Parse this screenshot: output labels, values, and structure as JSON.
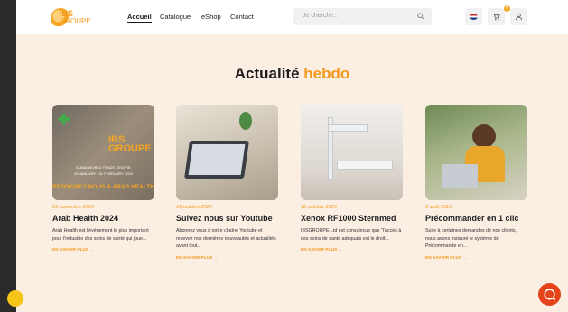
{
  "header": {
    "logo_text": "IBS",
    "logo_sub": "GROUPE",
    "nav": [
      "Accueil",
      "Catalogue",
      "eShop",
      "Contact"
    ],
    "search_placeholder": "Je cherche..",
    "cart_count": "0"
  },
  "section": {
    "title_part1": "Actualité",
    "title_part2": "hebdo"
  },
  "cards": [
    {
      "date": "29 novembre 2023",
      "title": "Arab Health 2024",
      "desc": "Arab Health est l'événement le plus important pour l'industrie des soins de santé qui joue...",
      "more": "EN SAVOIR PLUS →",
      "img_caption_1": "DUBAI WORLD TRADE CENTRE",
      "img_caption_2": "29 JANUARY - 01 FEBRUARY 2024",
      "img_banner": "REJOIGNEZ-NOUS À ARAB HEALTH",
      "img_brand": "IBS GROUPE"
    },
    {
      "date": "16 octobre 2023",
      "title": "Suivez nous sur Youtube",
      "desc": "Abonnez vous à notre chaîne Youtube et recevez nos dernières nouveautés et actualités avant tout...",
      "more": "EN SAVOIR PLUS →"
    },
    {
      "date": "16 octobre 2023",
      "title": "Xenox RF1000 Sternmed",
      "desc": "IBSGROUPE Ltd est convaincue que \"l'accès à des soins de santé adéquats est le droit...",
      "more": "EN SAVOIR PLUS →"
    },
    {
      "date": "9 août 2023",
      "title": "Précommander en 1 clic",
      "desc": "Suite à certaines demandes de nos clients, nous avons instauré le système de Précommande en...",
      "more": "EN SAVOIR PLUS →"
    }
  ],
  "colors": {
    "accent": "#f39a1e",
    "background": "#fbeee3",
    "chat": "#e5431a"
  },
  "icons": [
    "search-icon",
    "flag-icon",
    "cart-icon",
    "user-icon",
    "chat-icon"
  ]
}
